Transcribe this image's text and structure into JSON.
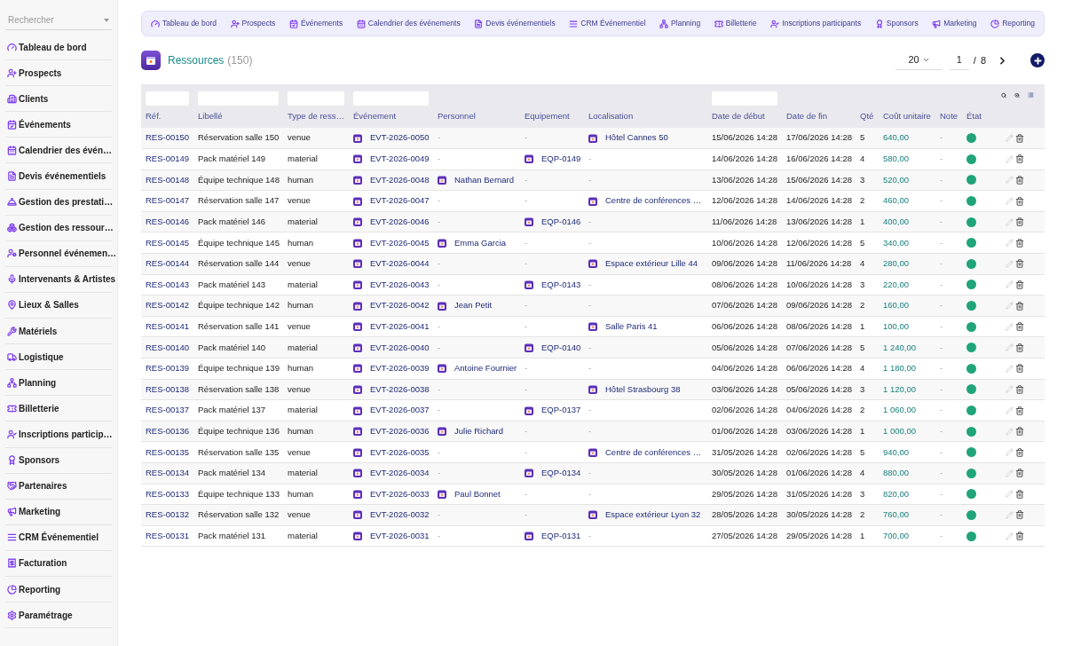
{
  "sidebar": {
    "search": {
      "placeholder": "Rechercher"
    },
    "items": [
      {
        "label": "Tableau de bord"
      },
      {
        "label": "Prospects"
      },
      {
        "label": "Clients"
      },
      {
        "label": "Événements"
      },
      {
        "label": "Calendrier des évén…"
      },
      {
        "label": "Devis événementiels"
      },
      {
        "label": "Gestion des prestati…"
      },
      {
        "label": "Gestion des ressour…"
      },
      {
        "label": "Personnel événemen…"
      },
      {
        "label": "Intervenants & Artistes"
      },
      {
        "label": "Lieux & Salles"
      },
      {
        "label": "Matériels"
      },
      {
        "label": "Logistique"
      },
      {
        "label": "Planning"
      },
      {
        "label": "Billetterie"
      },
      {
        "label": "Inscriptions particip…"
      },
      {
        "label": "Sponsors"
      },
      {
        "label": "Partenaires"
      },
      {
        "label": "Marketing"
      },
      {
        "label": "CRM Événementiel"
      },
      {
        "label": "Facturation"
      },
      {
        "label": "Reporting"
      },
      {
        "label": "Paramétrage"
      }
    ]
  },
  "top_nav": [
    {
      "label": "Tableau de bord"
    },
    {
      "label": "Prospects"
    },
    {
      "label": "Événements"
    },
    {
      "label": "Calendrier des événements"
    },
    {
      "label": "Devis événementiels"
    },
    {
      "label": "CRM Événementiel"
    },
    {
      "label": "Planning"
    },
    {
      "label": "Billetterie"
    },
    {
      "label": "Inscriptions participants"
    },
    {
      "label": "Sponsors"
    },
    {
      "label": "Marketing"
    },
    {
      "label": "Reporting"
    }
  ],
  "page": {
    "title": "Ressources",
    "count": "(150)"
  },
  "pagination": {
    "page_size": "20",
    "page": "1",
    "separator": "/",
    "total_pages": "8"
  },
  "table": {
    "columns": [
      "Réf.",
      "Libellé",
      "Type de ress…",
      "Événement",
      "Personnel",
      "Equipement",
      "Localisation",
      "Date de début",
      "Date de fin",
      "Qté",
      "Coût unitaire",
      "Note",
      "État"
    ],
    "filters": [
      true,
      true,
      true,
      true,
      false,
      false,
      false,
      true,
      false,
      false,
      false,
      false,
      false
    ],
    "rows": [
      {
        "ref": "RES-00150",
        "label": "Réservation salle 150",
        "type": "venue",
        "event": "EVT-2026-0050",
        "personnel": {
          "text": "-",
          "linked": false
        },
        "equipment": {
          "text": "-",
          "linked": false
        },
        "location": {
          "text": "Hôtel Cannes 50",
          "linked": true
        },
        "start": "15/06/2026 14:28",
        "end": "17/06/2026 14:28",
        "qty": "5",
        "cost": "640,00",
        "note": "-",
        "color": "#20a47a"
      },
      {
        "ref": "RES-00149",
        "label": "Pack matériel 149",
        "type": "material",
        "event": "EVT-2026-0049",
        "personnel": {
          "text": "-",
          "linked": false
        },
        "equipment": {
          "text": "EQP-0149",
          "linked": true
        },
        "location": {
          "text": "-",
          "linked": false
        },
        "start": "14/06/2026 14:28",
        "end": "16/06/2026 14:28",
        "qty": "4",
        "cost": "580,00",
        "note": "-",
        "color": "#20a47a"
      },
      {
        "ref": "RES-00148",
        "label": "Équipe technique 148",
        "type": "human",
        "event": "EVT-2026-0048",
        "personnel": {
          "text": "Nathan Bernard",
          "linked": true
        },
        "equipment": {
          "text": "-",
          "linked": false
        },
        "location": {
          "text": "-",
          "linked": false
        },
        "start": "13/06/2026 14:28",
        "end": "15/06/2026 14:28",
        "qty": "3",
        "cost": "520,00",
        "note": "-",
        "color": "#20a47a"
      },
      {
        "ref": "RES-00147",
        "label": "Réservation salle 147",
        "type": "venue",
        "event": "EVT-2026-0047",
        "personnel": {
          "text": "-",
          "linked": false
        },
        "equipment": {
          "text": "-",
          "linked": false
        },
        "location": {
          "text": "Centre de conférences …",
          "linked": true
        },
        "start": "12/06/2026 14:28",
        "end": "14/06/2026 14:28",
        "qty": "2",
        "cost": "460,00",
        "note": "-",
        "color": "#20a47a"
      },
      {
        "ref": "RES-00146",
        "label": "Pack matériel 146",
        "type": "material",
        "event": "EVT-2026-0046",
        "personnel": {
          "text": "-",
          "linked": false
        },
        "equipment": {
          "text": "EQP-0146",
          "linked": true
        },
        "location": {
          "text": "-",
          "linked": false
        },
        "start": "11/06/2026 14:28",
        "end": "13/06/2026 14:28",
        "qty": "1",
        "cost": "400,00",
        "note": "-",
        "color": "#20a47a"
      },
      {
        "ref": "RES-00145",
        "label": "Équipe technique 145",
        "type": "human",
        "event": "EVT-2026-0045",
        "personnel": {
          "text": "Emma Garcia",
          "linked": true
        },
        "equipment": {
          "text": "-",
          "linked": false
        },
        "location": {
          "text": "-",
          "linked": false
        },
        "start": "10/06/2026 14:28",
        "end": "12/06/2026 14:28",
        "qty": "5",
        "cost": "340,00",
        "note": "-",
        "color": "#20a47a"
      },
      {
        "ref": "RES-00144",
        "label": "Réservation salle 144",
        "type": "venue",
        "event": "EVT-2026-0044",
        "personnel": {
          "text": "-",
          "linked": false
        },
        "equipment": {
          "text": "-",
          "linked": false
        },
        "location": {
          "text": "Espace extérieur Lille 44",
          "linked": true
        },
        "start": "09/06/2026 14:28",
        "end": "11/06/2026 14:28",
        "qty": "4",
        "cost": "280,00",
        "note": "-",
        "color": "#20a47a"
      },
      {
        "ref": "RES-00143",
        "label": "Pack matériel 143",
        "type": "material",
        "event": "EVT-2026-0043",
        "personnel": {
          "text": "-",
          "linked": false
        },
        "equipment": {
          "text": "EQP-0143",
          "linked": true
        },
        "location": {
          "text": "-",
          "linked": false
        },
        "start": "08/06/2026 14:28",
        "end": "10/06/2026 14:28",
        "qty": "3",
        "cost": "220,00",
        "note": "-",
        "color": "#20a47a"
      },
      {
        "ref": "RES-00142",
        "label": "Équipe technique 142",
        "type": "human",
        "event": "EVT-2026-0042",
        "personnel": {
          "text": "Jean Petit",
          "linked": true
        },
        "equipment": {
          "text": "-",
          "linked": false
        },
        "location": {
          "text": "-",
          "linked": false
        },
        "start": "07/06/2026 14:28",
        "end": "09/06/2026 14:28",
        "qty": "2",
        "cost": "160,00",
        "note": "-",
        "color": "#20a47a"
      },
      {
        "ref": "RES-00141",
        "label": "Réservation salle 141",
        "type": "venue",
        "event": "EVT-2026-0041",
        "personnel": {
          "text": "-",
          "linked": false
        },
        "equipment": {
          "text": "-",
          "linked": false
        },
        "location": {
          "text": "Salle Paris 41",
          "linked": true
        },
        "start": "06/06/2026 14:28",
        "end": "08/06/2026 14:28",
        "qty": "1",
        "cost": "100,00",
        "note": "-",
        "color": "#20a47a"
      },
      {
        "ref": "RES-00140",
        "label": "Pack matériel 140",
        "type": "material",
        "event": "EVT-2026-0040",
        "personnel": {
          "text": "-",
          "linked": false
        },
        "equipment": {
          "text": "EQP-0140",
          "linked": true
        },
        "location": {
          "text": "-",
          "linked": false
        },
        "start": "05/06/2026 14:28",
        "end": "07/06/2026 14:28",
        "qty": "5",
        "cost": "1 240,00",
        "note": "-",
        "color": "#20a47a"
      },
      {
        "ref": "RES-00139",
        "label": "Équipe technique 139",
        "type": "human",
        "event": "EVT-2026-0039",
        "personnel": {
          "text": "Antoine Fournier",
          "linked": true
        },
        "equipment": {
          "text": "-",
          "linked": false
        },
        "location": {
          "text": "-",
          "linked": false
        },
        "start": "04/06/2026 14:28",
        "end": "06/06/2026 14:28",
        "qty": "4",
        "cost": "1 180,00",
        "note": "-",
        "color": "#20a47a"
      },
      {
        "ref": "RES-00138",
        "label": "Réservation salle 138",
        "type": "venue",
        "event": "EVT-2026-0038",
        "personnel": {
          "text": "-",
          "linked": false
        },
        "equipment": {
          "text": "-",
          "linked": false
        },
        "location": {
          "text": "Hôtel Strasbourg 38",
          "linked": true
        },
        "start": "03/06/2026 14:28",
        "end": "05/06/2026 14:28",
        "qty": "3",
        "cost": "1 120,00",
        "note": "-",
        "color": "#20a47a"
      },
      {
        "ref": "RES-00137",
        "label": "Pack matériel 137",
        "type": "material",
        "event": "EVT-2026-0037",
        "personnel": {
          "text": "-",
          "linked": false
        },
        "equipment": {
          "text": "EQP-0137",
          "linked": true
        },
        "location": {
          "text": "-",
          "linked": false
        },
        "start": "02/06/2026 14:28",
        "end": "04/06/2026 14:28",
        "qty": "2",
        "cost": "1 060,00",
        "note": "-",
        "color": "#20a47a"
      },
      {
        "ref": "RES-00136",
        "label": "Équipe technique 136",
        "type": "human",
        "event": "EVT-2026-0036",
        "personnel": {
          "text": "Julie Richard",
          "linked": true
        },
        "equipment": {
          "text": "-",
          "linked": false
        },
        "location": {
          "text": "-",
          "linked": false
        },
        "start": "01/06/2026 14:28",
        "end": "03/06/2026 14:28",
        "qty": "1",
        "cost": "1 000,00",
        "note": "-",
        "color": "#20a47a"
      },
      {
        "ref": "RES-00135",
        "label": "Réservation salle 135",
        "type": "venue",
        "event": "EVT-2026-0035",
        "personnel": {
          "text": "-",
          "linked": false
        },
        "equipment": {
          "text": "-",
          "linked": false
        },
        "location": {
          "text": "Centre de conférences …",
          "linked": true
        },
        "start": "31/05/2026 14:28",
        "end": "02/06/2026 14:28",
        "qty": "5",
        "cost": "940,00",
        "note": "-",
        "color": "#20a47a"
      },
      {
        "ref": "RES-00134",
        "label": "Pack matériel 134",
        "type": "material",
        "event": "EVT-2026-0034",
        "personnel": {
          "text": "-",
          "linked": false
        },
        "equipment": {
          "text": "EQP-0134",
          "linked": true
        },
        "location": {
          "text": "-",
          "linked": false
        },
        "start": "30/05/2026 14:28",
        "end": "01/06/2026 14:28",
        "qty": "4",
        "cost": "880,00",
        "note": "-",
        "color": "#20a47a"
      },
      {
        "ref": "RES-00133",
        "label": "Équipe technique 133",
        "type": "human",
        "event": "EVT-2026-0033",
        "personnel": {
          "text": "Paul Bonnet",
          "linked": true
        },
        "equipment": {
          "text": "-",
          "linked": false
        },
        "location": {
          "text": "-",
          "linked": false
        },
        "start": "29/05/2026 14:28",
        "end": "31/05/2026 14:28",
        "qty": "3",
        "cost": "820,00",
        "note": "-",
        "color": "#20a47a"
      },
      {
        "ref": "RES-00132",
        "label": "Réservation salle 132",
        "type": "venue",
        "event": "EVT-2026-0032",
        "personnel": {
          "text": "-",
          "linked": false
        },
        "equipment": {
          "text": "-",
          "linked": false
        },
        "location": {
          "text": "Espace extérieur Lyon 32",
          "linked": true
        },
        "start": "28/05/2026 14:28",
        "end": "30/05/2026 14:28",
        "qty": "2",
        "cost": "760,00",
        "note": "-",
        "color": "#20a47a"
      },
      {
        "ref": "RES-00131",
        "label": "Pack matériel 131",
        "type": "material",
        "event": "EVT-2026-0031",
        "personnel": {
          "text": "-",
          "linked": false
        },
        "equipment": {
          "text": "EQP-0131",
          "linked": true
        },
        "location": {
          "text": "-",
          "linked": false
        },
        "start": "27/05/2026 14:28",
        "end": "29/05/2026 14:28",
        "qty": "1",
        "cost": "700,00",
        "note": "-",
        "color": "#20a47a"
      }
    ]
  }
}
